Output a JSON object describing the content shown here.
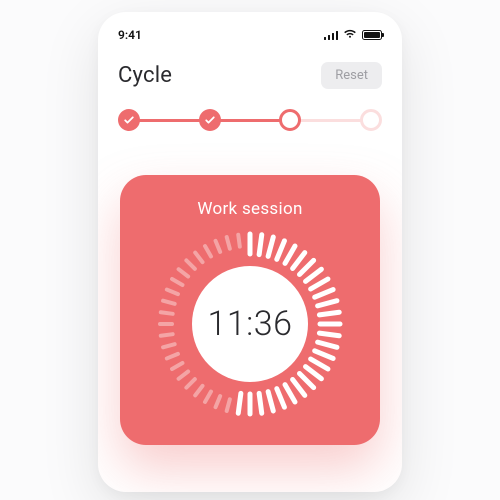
{
  "colors": {
    "accent": "#ee6c6e",
    "accent_faint": "#fbdede"
  },
  "statusbar": {
    "time": "9:41"
  },
  "header": {
    "title": "Cycle",
    "reset_label": "Reset"
  },
  "stepper": {
    "steps": [
      {
        "state": "done"
      },
      {
        "state": "done"
      },
      {
        "state": "current"
      },
      {
        "state": "future"
      }
    ]
  },
  "session": {
    "label": "Work session",
    "time": "11:36",
    "progress_fraction": 0.55
  }
}
